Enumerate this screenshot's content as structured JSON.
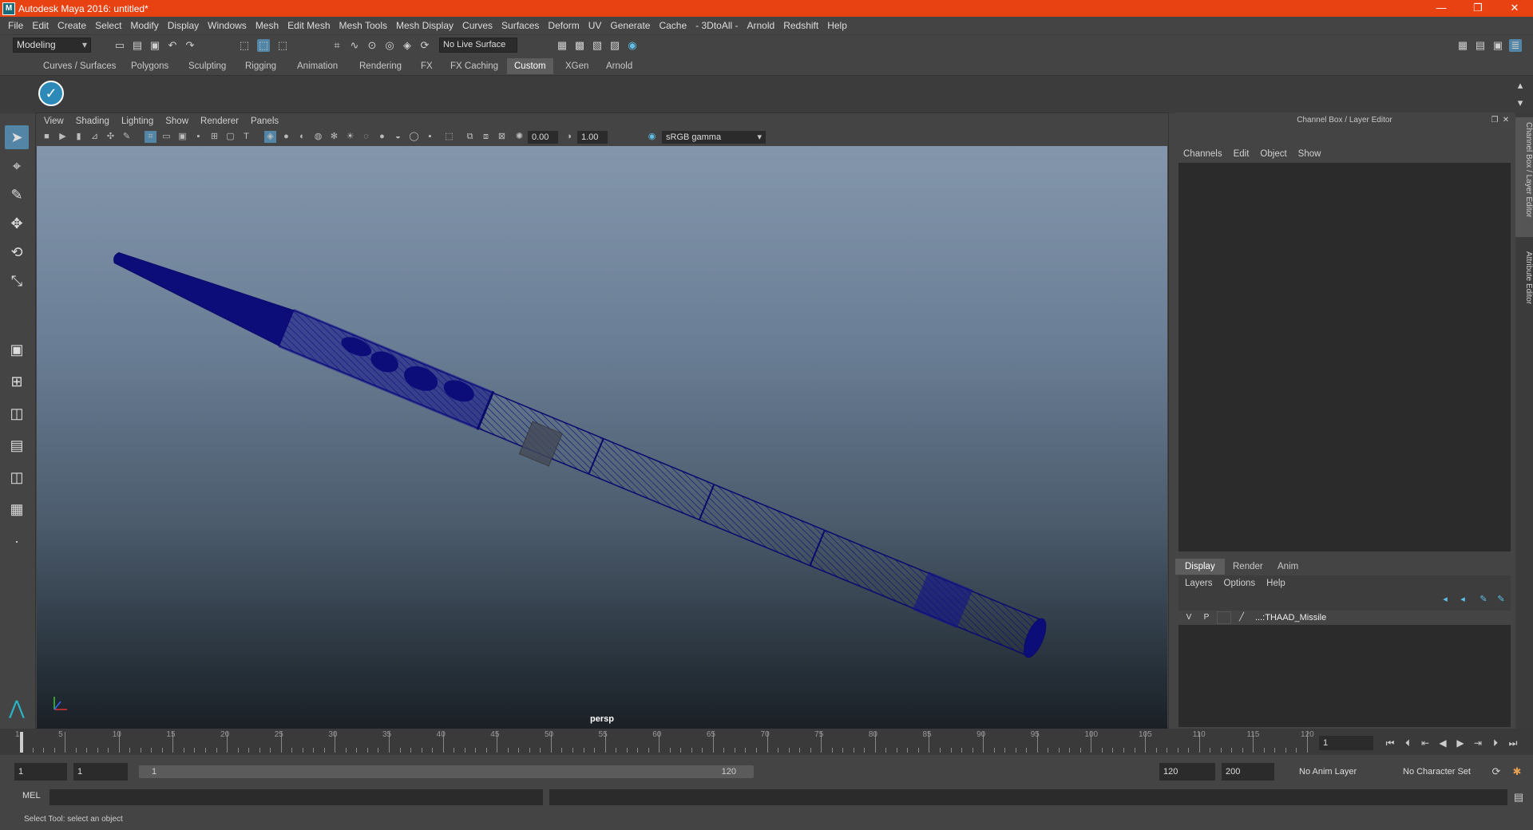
{
  "window": {
    "title": "Autodesk Maya 2016: untitled*",
    "icon": "maya-app-icon",
    "minimize": "—",
    "maximize": "❐",
    "close": "✕"
  },
  "menubar": [
    "File",
    "Edit",
    "Create",
    "Select",
    "Modify",
    "Display",
    "Windows",
    "Mesh",
    "Edit Mesh",
    "Mesh Tools",
    "Mesh Display",
    "Curves",
    "Surfaces",
    "Deform",
    "UV",
    "Generate",
    "Cache",
    "- 3DtoAll -",
    "Arnold",
    "Redshift",
    "Help"
  ],
  "statusline": {
    "mode": "Modeling",
    "live_surface": "No Live Surface"
  },
  "shelf": {
    "tabs": [
      "Curves / Surfaces",
      "Polygons",
      "Sculpting",
      "Rigging",
      "Animation",
      "Rendering",
      "FX",
      "FX Caching",
      "Custom",
      "XGen",
      "Arnold"
    ],
    "active_tab": "Custom",
    "item_icon": "checkmark-icon"
  },
  "viewport": {
    "menu": [
      "View",
      "Shading",
      "Lighting",
      "Show",
      "Renderer",
      "Panels"
    ],
    "exposure": "0.00",
    "gamma": "1.00",
    "color_space": "sRGB gamma",
    "camera_label": "persp",
    "object": "THAAD missile wireframe",
    "wire_color": "#0f0f7a"
  },
  "channel_box": {
    "title": "Channel Box / Layer Editor",
    "menu": [
      "Channels",
      "Edit",
      "Object",
      "Show"
    ]
  },
  "layer_editor": {
    "tabs": [
      "Display",
      "Render",
      "Anim"
    ],
    "active_tab": "Display",
    "menu": [
      "Layers",
      "Options",
      "Help"
    ],
    "layers": [
      {
        "visible": "V",
        "playback": "P",
        "name": "...:THAAD_Missile"
      }
    ]
  },
  "side_tabs": [
    "Channel Box / Layer Editor",
    "Attribute Editor"
  ],
  "timeslider": {
    "ticks": [
      1,
      5,
      10,
      15,
      20,
      25,
      30,
      35,
      40,
      45,
      50,
      55,
      60,
      65,
      70,
      75,
      80,
      85,
      90,
      95,
      100,
      105,
      110,
      115,
      120
    ],
    "current_frame": "1"
  },
  "range": {
    "start": "1",
    "playback_start": "1",
    "range_start_label": "1",
    "range_end_label": "120",
    "playback_end": "120",
    "end": "200",
    "anim_layer": "No Anim Layer",
    "character_set": "No Character Set"
  },
  "cmdline": {
    "label": "MEL"
  },
  "helpline": {
    "text": "Select Tool: select an object"
  },
  "colors": {
    "titlebar": "#e84112",
    "accent": "#5285a6",
    "panel": "#444444",
    "field": "#2b2b2b"
  }
}
